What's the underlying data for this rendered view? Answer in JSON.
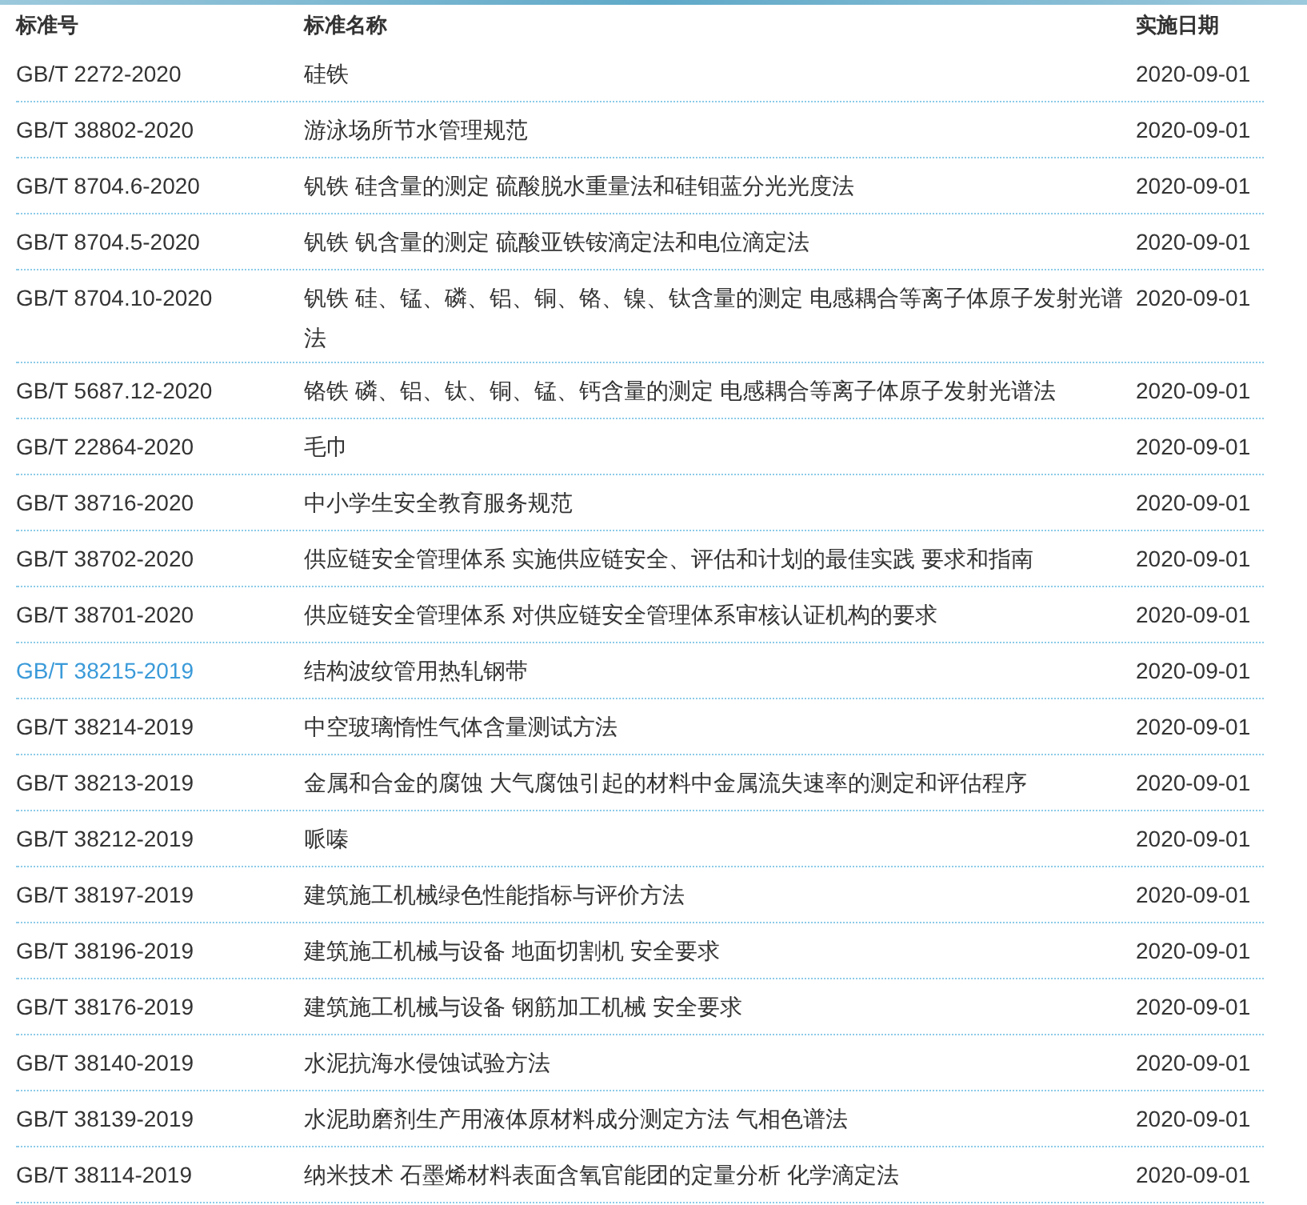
{
  "table": {
    "columns": [
      "标准号",
      "标准名称",
      "实施日期"
    ],
    "rows": [
      {
        "code": "GB/T 2272-2020",
        "name": "硅铁",
        "date": "2020-09-01",
        "highlighted": false
      },
      {
        "code": "GB/T 38802-2020",
        "name": "游泳场所节水管理规范",
        "date": "2020-09-01",
        "highlighted": false
      },
      {
        "code": "GB/T 8704.6-2020",
        "name": "钒铁 硅含量的测定 硫酸脱水重量法和硅钼蓝分光光度法",
        "date": "2020-09-01",
        "highlighted": false
      },
      {
        "code": "GB/T 8704.5-2020",
        "name": "钒铁 钒含量的测定 硫酸亚铁铵滴定法和电位滴定法",
        "date": "2020-09-01",
        "highlighted": false
      },
      {
        "code": "GB/T 8704.10-2020",
        "name": "钒铁 硅、锰、磷、铝、铜、铬、镍、钛含量的测定 电感耦合等离子体原子发射光谱法",
        "date": "2020-09-01",
        "highlighted": false
      },
      {
        "code": "GB/T 5687.12-2020",
        "name": "铬铁 磷、铝、钛、铜、锰、钙含量的测定 电感耦合等离子体原子发射光谱法",
        "date": "2020-09-01",
        "highlighted": false
      },
      {
        "code": "GB/T 22864-2020",
        "name": "毛巾",
        "date": "2020-09-01",
        "highlighted": false
      },
      {
        "code": "GB/T 38716-2020",
        "name": "中小学生安全教育服务规范",
        "date": "2020-09-01",
        "highlighted": false
      },
      {
        "code": "GB/T 38702-2020",
        "name": "供应链安全管理体系 实施供应链安全、评估和计划的最佳实践 要求和指南",
        "date": "2020-09-01",
        "highlighted": false
      },
      {
        "code": "GB/T 38701-2020",
        "name": "供应链安全管理体系 对供应链安全管理体系审核认证机构的要求",
        "date": "2020-09-01",
        "highlighted": false
      },
      {
        "code": "GB/T 38215-2019",
        "name": "结构波纹管用热轧钢带",
        "date": "2020-09-01",
        "highlighted": true
      },
      {
        "code": "GB/T 38214-2019",
        "name": "中空玻璃惰性气体含量测试方法",
        "date": "2020-09-01",
        "highlighted": false
      },
      {
        "code": "GB/T 38213-2019",
        "name": "金属和合金的腐蚀 大气腐蚀引起的材料中金属流失速率的测定和评估程序",
        "date": "2020-09-01",
        "highlighted": false
      },
      {
        "code": "GB/T 38212-2019",
        "name": "哌嗪",
        "date": "2020-09-01",
        "highlighted": false
      },
      {
        "code": "GB/T 38197-2019",
        "name": "建筑施工机械绿色性能指标与评价方法",
        "date": "2020-09-01",
        "highlighted": false
      },
      {
        "code": "GB/T 38196-2019",
        "name": "建筑施工机械与设备 地面切割机 安全要求",
        "date": "2020-09-01",
        "highlighted": false
      },
      {
        "code": "GB/T 38176-2019",
        "name": "建筑施工机械与设备 钢筋加工机械 安全要求",
        "date": "2020-09-01",
        "highlighted": false
      },
      {
        "code": "GB/T 38140-2019",
        "name": "水泥抗海水侵蚀试验方法",
        "date": "2020-09-01",
        "highlighted": false
      },
      {
        "code": "GB/T 38139-2019",
        "name": "水泥助磨剂生产用液体原材料成分测定方法 气相色谱法",
        "date": "2020-09-01",
        "highlighted": false
      },
      {
        "code": "GB/T 38114-2019",
        "name": "纳米技术 石墨烯材料表面含氧官能团的定量分析 化学滴定法",
        "date": "2020-09-01",
        "highlighted": false
      }
    ]
  }
}
